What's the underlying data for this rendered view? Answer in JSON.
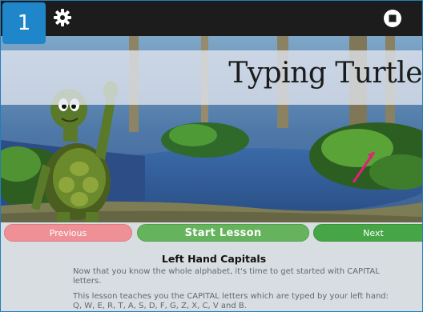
{
  "lesson_number": "1",
  "title": "Typing Turtle",
  "buttons": {
    "previous": "Previous",
    "start": "Start Lesson",
    "next": "Next"
  },
  "lesson": {
    "heading": "Left Hand Capitals",
    "paragraphs": [
      "Now that you know the whole alphabet, it's time to get started with CAPITAL letters.",
      "This lesson teaches you the CAPITAL letters which are typed by your left hand: Q, W, E, R, T, A, S, D, F, G, Z, X, C, V and B."
    ]
  },
  "icons": {
    "settings": "gear-icon",
    "quit": "stop-icon"
  },
  "colors": {
    "topbar": "#1c1c1c",
    "badge": "#1f86c9",
    "previous": "#ef8f96",
    "start": "#65b35d",
    "next": "#46a545"
  }
}
